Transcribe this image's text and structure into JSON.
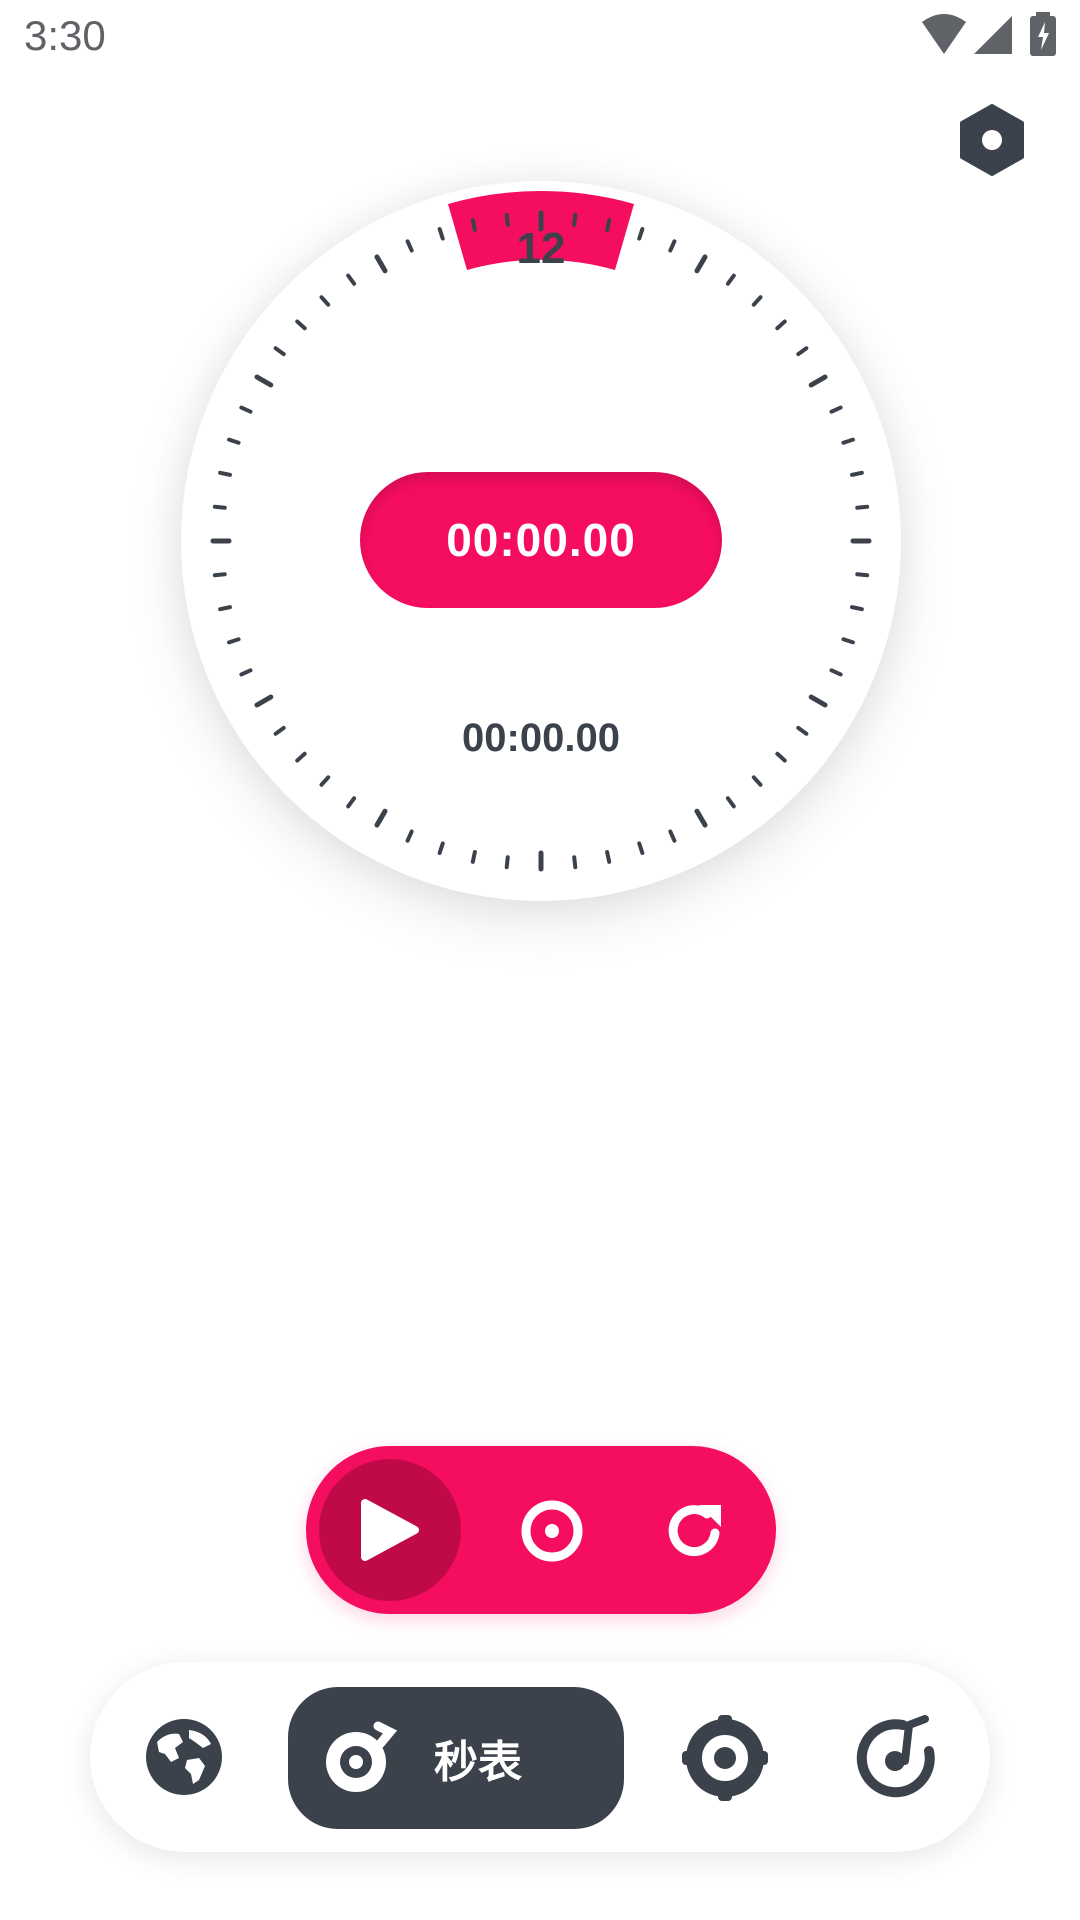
{
  "status_bar": {
    "time": "3:30",
    "icons": [
      "wifi-icon",
      "signal-icon",
      "battery-charging-icon"
    ]
  },
  "header": {
    "settings_icon": "settings-hexagon-icon"
  },
  "dial": {
    "top_marker": "12",
    "main_time": "00:00.00",
    "lap_time": "00:00.00"
  },
  "controls": {
    "play_icon": "play-icon",
    "lap_icon": "lap-target-icon",
    "reset_icon": "reset-icon"
  },
  "bottom_nav": {
    "items": [
      {
        "icon": "globe-icon"
      },
      {
        "icon": "stopwatch-icon",
        "label": "秒表",
        "active": true
      },
      {
        "icon": "timer-icon"
      },
      {
        "icon": "music-note-icon"
      }
    ]
  },
  "colors": {
    "accent": "#f50d60",
    "accent_dark": "#bf0a47",
    "dark": "#3c424b",
    "background": "#ffffff"
  }
}
